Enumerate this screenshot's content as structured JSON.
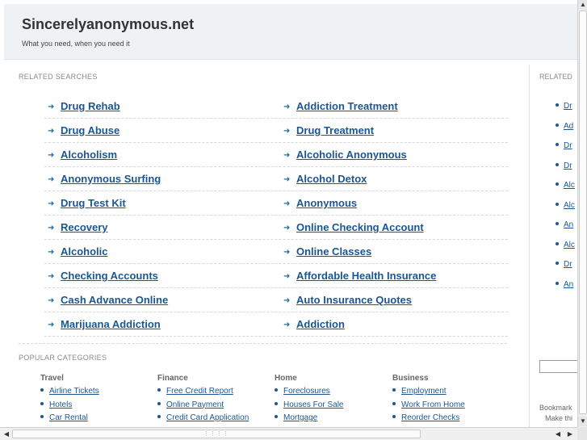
{
  "header": {
    "title": "Sincerelyanonymous.net",
    "tagline": "What you need, when you need it"
  },
  "related_searches": {
    "label": "RELATED SEARCHES",
    "left": [
      "Drug Rehab",
      "Drug Abuse",
      "Alcoholism",
      "Anonymous Surfing",
      "Drug Test Kit",
      "Recovery",
      "Alcoholic",
      "Checking Accounts",
      "Cash Advance Online",
      "Marijuana Addiction"
    ],
    "right": [
      "Addiction Treatment",
      "Drug Treatment",
      "Alcoholic Anonymous",
      "Alcohol Detox",
      "Anonymous",
      "Online Checking Account",
      "Online Classes",
      "Affordable Health Insurance",
      "Auto Insurance Quotes",
      "Addiction"
    ]
  },
  "popular": {
    "label": "POPULAR CATEGORIES",
    "columns": [
      {
        "heading": "Travel",
        "items": [
          "Airline Tickets",
          "Hotels",
          "Car Rental"
        ]
      },
      {
        "heading": "Finance",
        "items": [
          "Free Credit Report",
          "Online Payment",
          "Credit Card Application"
        ]
      },
      {
        "heading": "Home",
        "items": [
          "Foreclosures",
          "Houses For Sale",
          "Mortgage"
        ]
      },
      {
        "heading": "Business",
        "items": [
          "Employment",
          "Work From Home",
          "Reorder Checks"
        ]
      }
    ]
  },
  "sidebar": {
    "label": "RELATED",
    "items": [
      "Dr",
      "Ad",
      "Dr",
      "Dr",
      "Alc",
      "Alc",
      "An",
      "Alc",
      "Dr",
      "An"
    ],
    "bookmark": "Bookmark",
    "make": "Make thi"
  },
  "scrollbars": {
    "up_glyph": "▲",
    "down_glyph": "▼",
    "left_glyph": "◀",
    "right_glyph": "▶",
    "grip": "⋮⋮⋮⋮"
  }
}
